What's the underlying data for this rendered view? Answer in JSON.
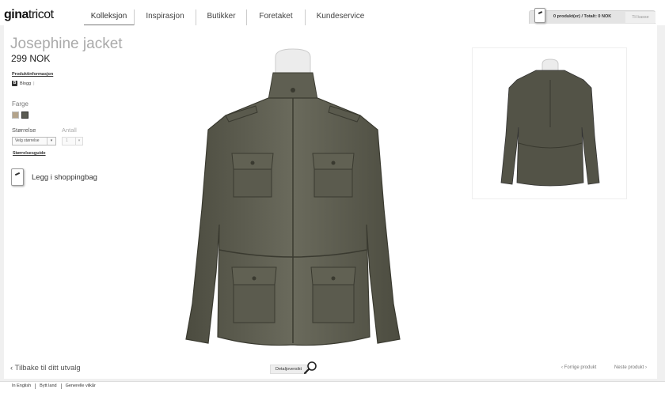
{
  "brand": {
    "logo_bold": "gina",
    "logo_light": "tricot"
  },
  "nav": {
    "items": [
      {
        "label": "Kolleksjon",
        "active": true
      },
      {
        "label": "Inspirasjon",
        "active": false
      },
      {
        "label": "Butikker",
        "active": false
      },
      {
        "label": "Foretaket",
        "active": false
      },
      {
        "label": "Kundeservice",
        "active": false
      }
    ]
  },
  "cart": {
    "summary": "0 produkt(er) / Totalt: 0 NOK",
    "checkout_label": "Til kasse"
  },
  "product": {
    "title": "Josephine jacket",
    "price": "299 NOK",
    "info_link": "Produktinformasjon",
    "blog_label": "Blogg",
    "blog_icon_letter": "B",
    "color_label": "Farge",
    "colors": [
      "#b3a38a",
      "#5a5b52"
    ],
    "size_label": "Størrelse",
    "size_select": "Velg størrelse",
    "qty_label": "Antall",
    "qty_value": "1",
    "size_guide": "Størrelsesguide",
    "add_to_bag": "Legg i shoppingbag"
  },
  "bottom": {
    "back_link": "‹ Tilbake til ditt utvalg",
    "detail_view": "Detaljoversikt",
    "prev_product": "‹ Forrige produkt",
    "next_product": "Neste produkt ›"
  },
  "footer": {
    "links": [
      "In English",
      "Bytt land",
      "Generelle vilkår"
    ]
  }
}
